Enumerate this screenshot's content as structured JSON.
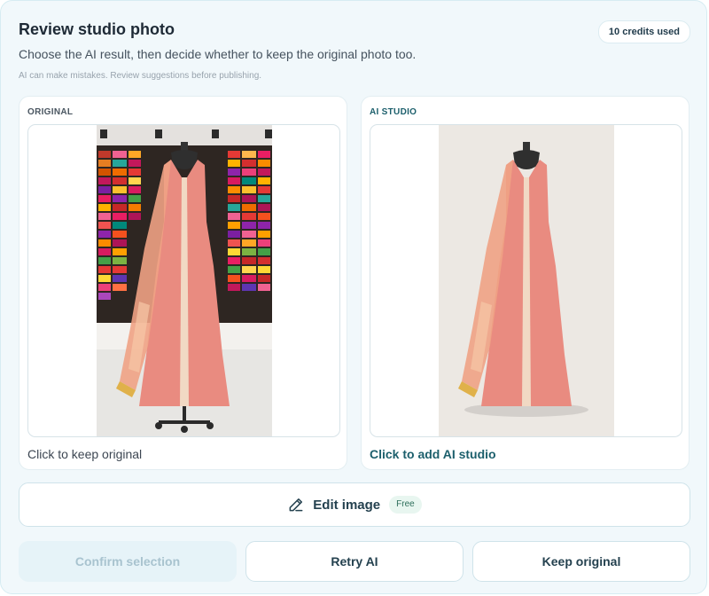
{
  "header": {
    "title": "Review studio photo",
    "credits_badge": "10 credits used",
    "subtitle": "Choose the AI result, then decide whether to keep the original photo too.",
    "disclaimer": "AI can make mistakes. Review suggestions before publishing."
  },
  "original": {
    "label": "ORIGINAL",
    "caption": "Click to keep original"
  },
  "ai_studio": {
    "label": "AI STUDIO",
    "caption": "Click to add AI studio"
  },
  "edit": {
    "label": "Edit image",
    "badge": "Free",
    "icon": "pencil-icon"
  },
  "actions": {
    "confirm": "Confirm selection",
    "retry": "Retry AI",
    "keep": "Keep original"
  },
  "colors": {
    "accent": "#1c5f6c",
    "panel_bg": "#f1f8fb",
    "dress": "#e98b80"
  }
}
